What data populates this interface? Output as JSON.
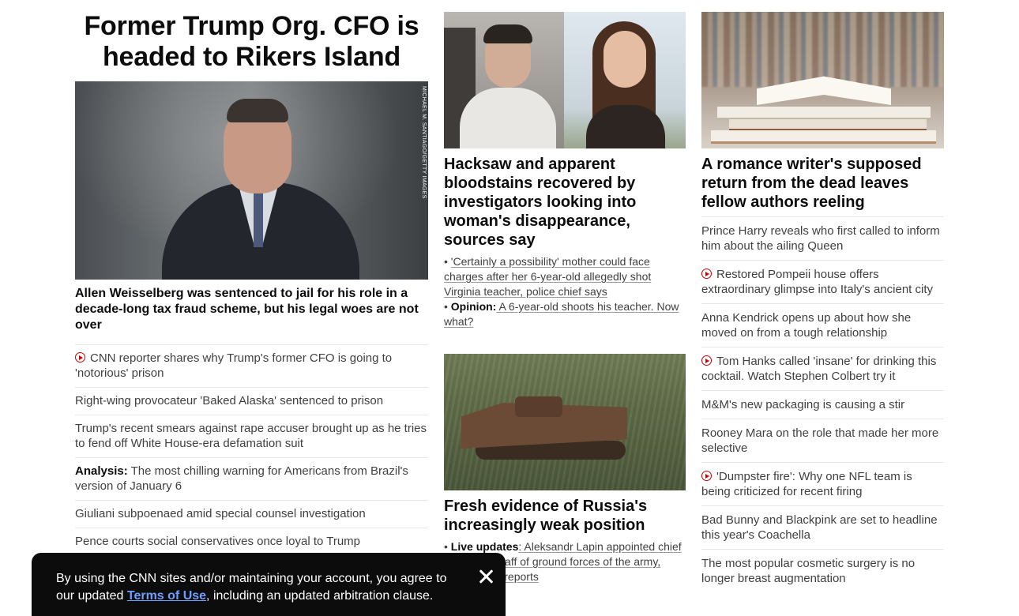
{
  "col1": {
    "headline": "Former Trump Org. CFO is headed to Rikers Island",
    "image_credit": "MICHAEL M. SANTIAGO/GETTY IMAGES",
    "caption": "Allen Weisselberg was sentenced to jail for his role in a decade-long tax fraud scheme, but his legal woes are not over",
    "links": [
      {
        "icon": "play-icon",
        "prefix": "",
        "text": "CNN reporter shares why Trump's former CFO is going to 'notorious' prison"
      },
      {
        "icon": "",
        "prefix": "",
        "text": "Right-wing provocateur 'Baked Alaska' sentenced to prison"
      },
      {
        "icon": "",
        "prefix": "",
        "text": "Trump's recent smears against rape accuser brought up as he tries to fend off White House-era defamation suit"
      },
      {
        "icon": "",
        "prefix": "Analysis:",
        "text": " The most chilling warning for Americans from Brazil's version of January 6"
      },
      {
        "icon": "",
        "prefix": "",
        "text": "Giuliani subpoenaed amid special counsel investigation"
      },
      {
        "icon": "",
        "prefix": "",
        "text": "Pence courts social conservatives once loyal to Trump"
      }
    ]
  },
  "col2": {
    "story1": {
      "title": "Hacksaw and apparent bloodstains recovered by investigators looking into woman's disappearance, sources say",
      "bullet1": "'Certainly a possibility' mother could face charges after her 6-year-old allegedly shot Virginia teacher, police chief says",
      "bullet2_prefix": "Opinion:",
      "bullet2_text": " A 6-year-old shoots his teacher. Now what?"
    },
    "story2": {
      "title": "Fresh evidence of Russia's increasingly weak position",
      "bullet1_prefix": "Live updates",
      "bullet1_text": ": Aleksandr Lapin appointed chief of general staff of ground forces of the army, state media reports"
    }
  },
  "col3": {
    "title": "A romance writer's supposed return from the dead leaves fellow authors reeling",
    "links": [
      {
        "icon": "",
        "text": "Prince Harry reveals who first called to inform him about the ailing Queen"
      },
      {
        "icon": "play-icon",
        "text": "Restored Pompeii house offers extraordinary glimpse into Italy's ancient city"
      },
      {
        "icon": "",
        "text": "Anna Kendrick opens up about how she moved on from a tough relationship"
      },
      {
        "icon": "play-icon",
        "text": "Tom Hanks called 'insane' for drinking this cocktail. Watch Stephen Colbert try it"
      },
      {
        "icon": "",
        "text": "M&M's new packaging is causing a stir"
      },
      {
        "icon": "",
        "text": "Rooney Mara on the role that made her more selective"
      },
      {
        "icon": "play-icon",
        "text": "'Dumpster fire': Why one NFL team is being criticized for recent firing"
      },
      {
        "icon": "",
        "text": "Bad Bunny and Blackpink are set to headline this year's Coachella"
      },
      {
        "icon": "",
        "text": "The most popular cosmetic surgery is no longer breast augmentation"
      }
    ]
  },
  "banner": {
    "text_before": "By using the CNN sites and/or maintaining your account, you agree to our updated ",
    "link": "Terms of Use",
    "text_after": ", including an updated arbitration clause.",
    "close_icon": "close-icon"
  },
  "colors": {
    "text": "#0c0c0c",
    "secondary_text": "#404040",
    "video_icon": "#cc0000",
    "banner_bg": "#0c0c0c",
    "banner_link": "#6e9fff"
  }
}
